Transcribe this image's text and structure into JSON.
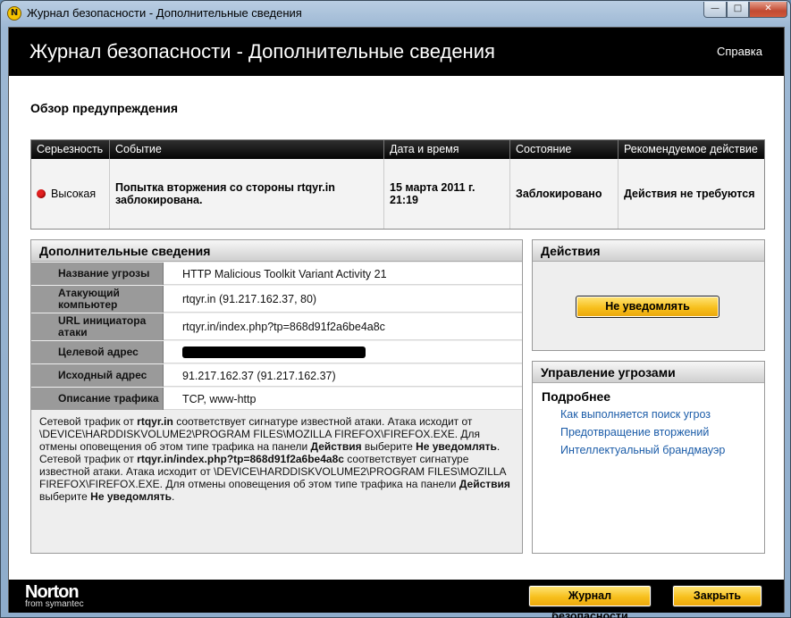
{
  "window": {
    "title": "Журнал безопасности - Дополнительные сведения",
    "icon_letter": "N"
  },
  "header": {
    "title": "Журнал безопасности - Дополнительные сведения",
    "help": "Справка"
  },
  "overview": {
    "title": "Обзор предупреждения"
  },
  "alert_table": {
    "columns": [
      "Серьезность",
      "Событие",
      "Дата и время",
      "Состояние",
      "Рекомендуемое действие"
    ],
    "row": {
      "severity": "Высокая",
      "event": "Попытка вторжения со стороны rtqyr.in заблокирована.",
      "datetime": "15 марта 2011 г. 21:19",
      "status": "Заблокировано",
      "action": "Действия не требуются"
    }
  },
  "details": {
    "title": "Дополнительные сведения",
    "rows": [
      {
        "label": "Название угрозы",
        "value": "HTTP Malicious Toolkit Variant Activity 21"
      },
      {
        "label": "Атакующий компьютер",
        "value": "rtqyr.in (91.217.162.37, 80)"
      },
      {
        "label": "URL инициатора атаки",
        "value": "rtqyr.in/index.php?tp=868d91f2a6be4a8c"
      },
      {
        "label": "Целевой адрес",
        "value": ""
      },
      {
        "label": "Исходный адрес",
        "value": "91.217.162.37 (91.217.162.37)"
      },
      {
        "label": "Описание трафика",
        "value": "TCP, www-http"
      }
    ],
    "description": {
      "p1_a": "Сетевой трафик от ",
      "p1_b": "rtqyr.in",
      "p1_c": " соответствует сигнатуре известной атаки. Атака исходит от \\DEVICE\\HARDDISKVOLUME2\\PROGRAM FILES\\MOZILLA FIREFOX\\FIREFOX.EXE. Для отмены оповещения об этом типе трафика на панели ",
      "p1_d": "Действия",
      "p1_e": " выберите ",
      "p1_f": "Не уведомлять",
      "p1_g": ".",
      "p2_a": "Сетевой трафик от ",
      "p2_b": "rtqyr.in/index.php?tp=868d91f2a6be4a8c",
      "p2_c": " соответствует сигнатуре известной атаки. Атака исходит от \\DEVICE\\HARDDISKVOLUME2\\PROGRAM FILES\\MOZILLA FIREFOX\\FIREFOX.EXE. Для отмены оповещения об этом типе трафика на панели ",
      "p2_d": "Действия",
      "p2_e": " выберите ",
      "p2_f": "Не уведомлять",
      "p2_g": "."
    }
  },
  "actions": {
    "title": "Действия",
    "do_not_notify": "Не уведомлять"
  },
  "threat_mgmt": {
    "title": "Управление угрозами",
    "more": "Подробнее",
    "links": [
      "Как выполняется поиск угроз",
      "Предотвращение вторжений",
      "Интеллектуальный брандмауэр"
    ]
  },
  "footer": {
    "brand": "Norton",
    "brand_sub": "from symantec",
    "security_log": "Журнал безопасности",
    "close": "Закрыть"
  },
  "colors": {
    "accent_yellow": "#f7bf1c",
    "severity_high": "#e21f1f",
    "link": "#1b5ca8"
  }
}
